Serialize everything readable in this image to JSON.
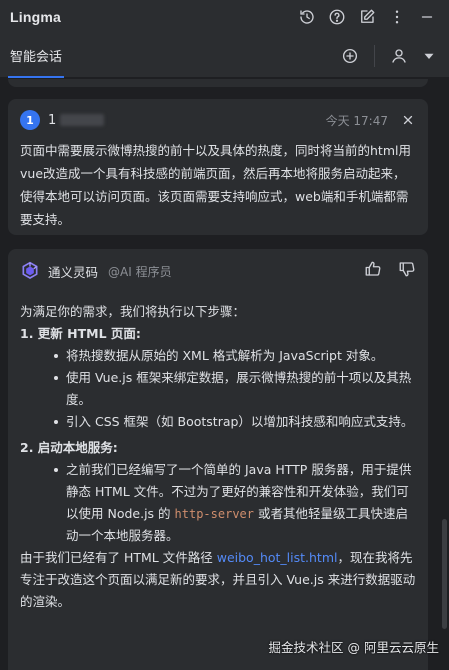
{
  "app": {
    "title": "Lingma"
  },
  "tabs": [
    {
      "label": "智能会话"
    }
  ],
  "user_message": {
    "avatar": "1",
    "name": "1",
    "time": "今天 17:47",
    "text": "页面中需要展示微博热搜的前十以及具体的热度，同时将当前的html用vue改造成一个具有科技感的前端页面，然后再本地将服务启动起来，使得本地可以访问页面。该页面需要支持响应式，web端和手机端都需要支持。"
  },
  "ai_message": {
    "name": "通义灵码",
    "role": "@AI 程序员",
    "intro": "为满足你的需求，我们将执行以下步骤：",
    "step1_title": "1. 更新 HTML 页面:",
    "step1_b1": "将热搜数据从原始的 XML 格式解析为 JavaScript 对象。",
    "step1_b2": "使用 Vue.js 框架来绑定数据，展示微博热搜的前十项以及其热度。",
    "step1_b3": "引入 CSS 框架（如 Bootstrap）以增加科技感和响应式支持。",
    "step2_title": "2. 启动本地服务:",
    "step2_b1_a": "之前我们已经编写了一个简单的 Java HTTP 服务器，用于提供静态 HTML 文件。不过为了更好的兼容性和开发体验，我们可以使用 Node.js 的 ",
    "step2_b1_code": "http-server",
    "step2_b1_b": " 或者其他轻量级工具快速启动一个本地服务器。",
    "outro_a": "由于我们已经有了 HTML 文件路径 ",
    "outro_link": "weibo_hot_list.html",
    "outro_b": "，现在我将先专注于改造这个页面以满足新的要求，并且引入 Vue.js 来进行数据驱动的渲染。"
  },
  "watermark": "掘金技术社区 @ 阿里云云原生",
  "icons": {
    "history": "history-icon",
    "help": "help-icon",
    "edit": "edit-icon",
    "more": "more-vertical-icon",
    "minimize": "minimize-icon",
    "add": "add-circle-icon",
    "user": "user-icon",
    "dropdown": "chevron-down-icon",
    "close": "close-icon",
    "thumb_up": "thumb-up-icon",
    "thumb_down": "thumb-down-icon",
    "logo": "tongyi-logo-icon"
  },
  "colors": {
    "accent": "#3574f0",
    "link": "#548af7",
    "code": "#cf8e6d",
    "background": "#1e1f22",
    "panel": "#2b2d30"
  }
}
